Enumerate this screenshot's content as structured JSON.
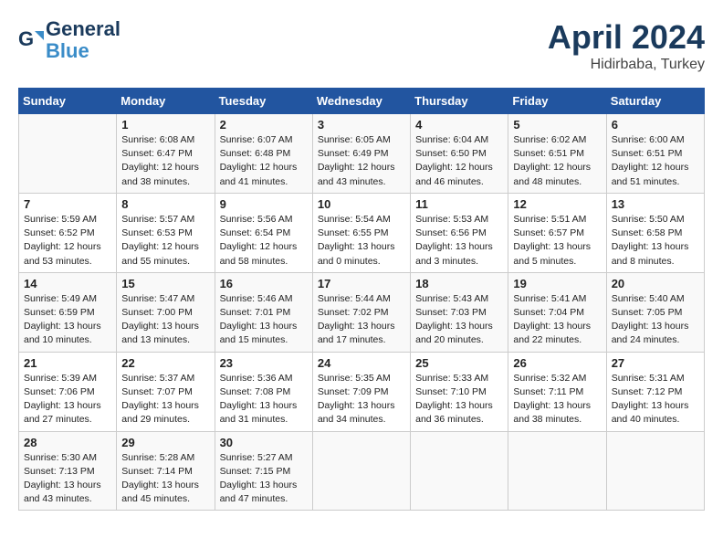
{
  "header": {
    "logo_line1": "General",
    "logo_line2": "Blue",
    "month": "April 2024",
    "location": "Hidirbaba, Turkey"
  },
  "columns": [
    "Sunday",
    "Monday",
    "Tuesday",
    "Wednesday",
    "Thursday",
    "Friday",
    "Saturday"
  ],
  "weeks": [
    [
      {
        "num": "",
        "sunrise": "",
        "sunset": "",
        "daylight": ""
      },
      {
        "num": "1",
        "sunrise": "Sunrise: 6:08 AM",
        "sunset": "Sunset: 6:47 PM",
        "daylight": "Daylight: 12 hours and 38 minutes."
      },
      {
        "num": "2",
        "sunrise": "Sunrise: 6:07 AM",
        "sunset": "Sunset: 6:48 PM",
        "daylight": "Daylight: 12 hours and 41 minutes."
      },
      {
        "num": "3",
        "sunrise": "Sunrise: 6:05 AM",
        "sunset": "Sunset: 6:49 PM",
        "daylight": "Daylight: 12 hours and 43 minutes."
      },
      {
        "num": "4",
        "sunrise": "Sunrise: 6:04 AM",
        "sunset": "Sunset: 6:50 PM",
        "daylight": "Daylight: 12 hours and 46 minutes."
      },
      {
        "num": "5",
        "sunrise": "Sunrise: 6:02 AM",
        "sunset": "Sunset: 6:51 PM",
        "daylight": "Daylight: 12 hours and 48 minutes."
      },
      {
        "num": "6",
        "sunrise": "Sunrise: 6:00 AM",
        "sunset": "Sunset: 6:51 PM",
        "daylight": "Daylight: 12 hours and 51 minutes."
      }
    ],
    [
      {
        "num": "7",
        "sunrise": "Sunrise: 5:59 AM",
        "sunset": "Sunset: 6:52 PM",
        "daylight": "Daylight: 12 hours and 53 minutes."
      },
      {
        "num": "8",
        "sunrise": "Sunrise: 5:57 AM",
        "sunset": "Sunset: 6:53 PM",
        "daylight": "Daylight: 12 hours and 55 minutes."
      },
      {
        "num": "9",
        "sunrise": "Sunrise: 5:56 AM",
        "sunset": "Sunset: 6:54 PM",
        "daylight": "Daylight: 12 hours and 58 minutes."
      },
      {
        "num": "10",
        "sunrise": "Sunrise: 5:54 AM",
        "sunset": "Sunset: 6:55 PM",
        "daylight": "Daylight: 13 hours and 0 minutes."
      },
      {
        "num": "11",
        "sunrise": "Sunrise: 5:53 AM",
        "sunset": "Sunset: 6:56 PM",
        "daylight": "Daylight: 13 hours and 3 minutes."
      },
      {
        "num": "12",
        "sunrise": "Sunrise: 5:51 AM",
        "sunset": "Sunset: 6:57 PM",
        "daylight": "Daylight: 13 hours and 5 minutes."
      },
      {
        "num": "13",
        "sunrise": "Sunrise: 5:50 AM",
        "sunset": "Sunset: 6:58 PM",
        "daylight": "Daylight: 13 hours and 8 minutes."
      }
    ],
    [
      {
        "num": "14",
        "sunrise": "Sunrise: 5:49 AM",
        "sunset": "Sunset: 6:59 PM",
        "daylight": "Daylight: 13 hours and 10 minutes."
      },
      {
        "num": "15",
        "sunrise": "Sunrise: 5:47 AM",
        "sunset": "Sunset: 7:00 PM",
        "daylight": "Daylight: 13 hours and 13 minutes."
      },
      {
        "num": "16",
        "sunrise": "Sunrise: 5:46 AM",
        "sunset": "Sunset: 7:01 PM",
        "daylight": "Daylight: 13 hours and 15 minutes."
      },
      {
        "num": "17",
        "sunrise": "Sunrise: 5:44 AM",
        "sunset": "Sunset: 7:02 PM",
        "daylight": "Daylight: 13 hours and 17 minutes."
      },
      {
        "num": "18",
        "sunrise": "Sunrise: 5:43 AM",
        "sunset": "Sunset: 7:03 PM",
        "daylight": "Daylight: 13 hours and 20 minutes."
      },
      {
        "num": "19",
        "sunrise": "Sunrise: 5:41 AM",
        "sunset": "Sunset: 7:04 PM",
        "daylight": "Daylight: 13 hours and 22 minutes."
      },
      {
        "num": "20",
        "sunrise": "Sunrise: 5:40 AM",
        "sunset": "Sunset: 7:05 PM",
        "daylight": "Daylight: 13 hours and 24 minutes."
      }
    ],
    [
      {
        "num": "21",
        "sunrise": "Sunrise: 5:39 AM",
        "sunset": "Sunset: 7:06 PM",
        "daylight": "Daylight: 13 hours and 27 minutes."
      },
      {
        "num": "22",
        "sunrise": "Sunrise: 5:37 AM",
        "sunset": "Sunset: 7:07 PM",
        "daylight": "Daylight: 13 hours and 29 minutes."
      },
      {
        "num": "23",
        "sunrise": "Sunrise: 5:36 AM",
        "sunset": "Sunset: 7:08 PM",
        "daylight": "Daylight: 13 hours and 31 minutes."
      },
      {
        "num": "24",
        "sunrise": "Sunrise: 5:35 AM",
        "sunset": "Sunset: 7:09 PM",
        "daylight": "Daylight: 13 hours and 34 minutes."
      },
      {
        "num": "25",
        "sunrise": "Sunrise: 5:33 AM",
        "sunset": "Sunset: 7:10 PM",
        "daylight": "Daylight: 13 hours and 36 minutes."
      },
      {
        "num": "26",
        "sunrise": "Sunrise: 5:32 AM",
        "sunset": "Sunset: 7:11 PM",
        "daylight": "Daylight: 13 hours and 38 minutes."
      },
      {
        "num": "27",
        "sunrise": "Sunrise: 5:31 AM",
        "sunset": "Sunset: 7:12 PM",
        "daylight": "Daylight: 13 hours and 40 minutes."
      }
    ],
    [
      {
        "num": "28",
        "sunrise": "Sunrise: 5:30 AM",
        "sunset": "Sunset: 7:13 PM",
        "daylight": "Daylight: 13 hours and 43 minutes."
      },
      {
        "num": "29",
        "sunrise": "Sunrise: 5:28 AM",
        "sunset": "Sunset: 7:14 PM",
        "daylight": "Daylight: 13 hours and 45 minutes."
      },
      {
        "num": "30",
        "sunrise": "Sunrise: 5:27 AM",
        "sunset": "Sunset: 7:15 PM",
        "daylight": "Daylight: 13 hours and 47 minutes."
      },
      {
        "num": "",
        "sunrise": "",
        "sunset": "",
        "daylight": ""
      },
      {
        "num": "",
        "sunrise": "",
        "sunset": "",
        "daylight": ""
      },
      {
        "num": "",
        "sunrise": "",
        "sunset": "",
        "daylight": ""
      },
      {
        "num": "",
        "sunrise": "",
        "sunset": "",
        "daylight": ""
      }
    ]
  ]
}
